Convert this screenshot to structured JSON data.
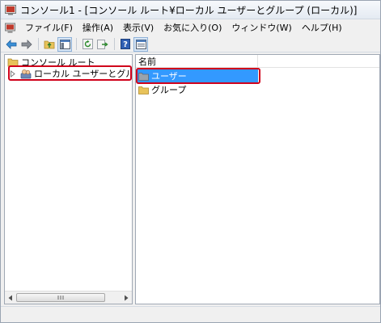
{
  "window": {
    "title": "コンソール1 - [コンソール ルート¥ローカル ユーザーとグループ (ローカル)]"
  },
  "menubar": {
    "items": [
      {
        "label": "ファイル(F)"
      },
      {
        "label": "操作(A)"
      },
      {
        "label": "表示(V)"
      },
      {
        "label": "お気に入り(O)"
      },
      {
        "label": "ウィンドウ(W)"
      },
      {
        "label": "ヘルプ(H)"
      }
    ]
  },
  "toolbar": {
    "buttons": [
      "back-arrow-icon",
      "forward-arrow-icon",
      "up-folder-icon",
      "show-hide-tree-icon",
      "refresh-icon",
      "export-list-icon",
      "help-icon",
      "properties-icon"
    ]
  },
  "tree": {
    "root": {
      "label": "コンソール ルート"
    },
    "child": {
      "label": "ローカル ユーザーとグループ"
    }
  },
  "list": {
    "column_header": "名前",
    "items": [
      {
        "label": "ユーザー",
        "selected": true
      },
      {
        "label": "グループ",
        "selected": false
      }
    ]
  },
  "scrollbar": {
    "grip": "III"
  },
  "colors": {
    "selection": "#3399ff",
    "highlight_box": "#d0021b",
    "folder": "#e8c35a"
  }
}
